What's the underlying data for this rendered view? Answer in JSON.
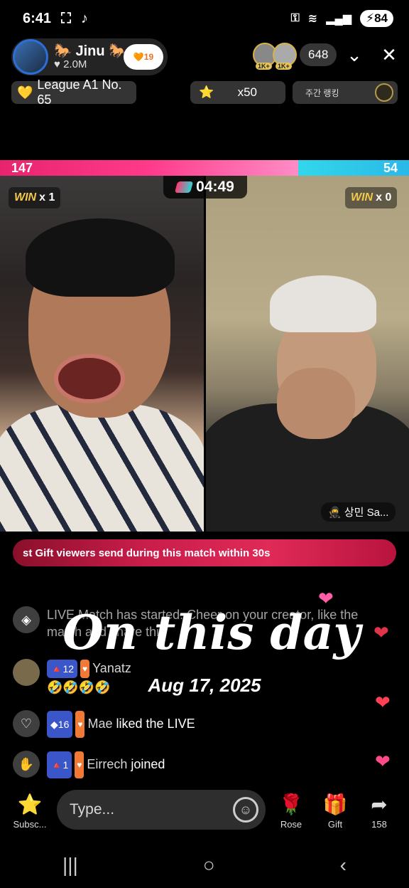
{
  "status_bar": {
    "time": "6:41",
    "battery": "84"
  },
  "host": {
    "name": "Jinu",
    "likes": "2.0M",
    "follow_badge": "19"
  },
  "viewers": {
    "badge_1": "1K+",
    "badge_2": "1K+",
    "count": "648"
  },
  "league": {
    "label": "League A1 No. 65"
  },
  "multiplier": {
    "label": "x50"
  },
  "weekly_ranking": {
    "label": "주간 랭킹"
  },
  "battle": {
    "score_left": "147",
    "score_right": "54",
    "timer": "04:49",
    "win_left_label": "WIN",
    "win_left_count": "x 1",
    "win_right_label": "WIN",
    "win_right_count": "x 0",
    "opponent_name": "상민 Sa...",
    "left_score_share": 0.73
  },
  "banner": {
    "text": "st Gift viewers send during this match within 30s"
  },
  "chat": [
    {
      "text": "LIVE Match has started. Cheer on your creator, like the match and share this"
    },
    {
      "level": "12",
      "user": "Yanatz",
      "message": "🤣🤣🤣🤣"
    },
    {
      "level": "16",
      "user": "Mae",
      "message": "liked the LIVE"
    },
    {
      "level": "1",
      "user": "Eirrech",
      "message": "joined"
    }
  ],
  "overlay": {
    "title": "On this day",
    "date": "Aug 17, 2025"
  },
  "bottom_bar": {
    "subscribe_label": "Subsc...",
    "type_placeholder": "Type...",
    "rose_label": "Rose",
    "gift_label": "Gift",
    "share_count": "158"
  },
  "colors": {
    "pink": "#e8246f",
    "cyan": "#32d7ea",
    "gold": "#f2c94c"
  },
  "icons": [
    "key-icon",
    "wifi-icon",
    "signal-icon",
    "chevron-down-icon",
    "close-icon",
    "diamond-icon",
    "emoji-icon",
    "rose-icon",
    "gift-icon",
    "share-icon",
    "heart-icon",
    "wave-icon"
  ]
}
